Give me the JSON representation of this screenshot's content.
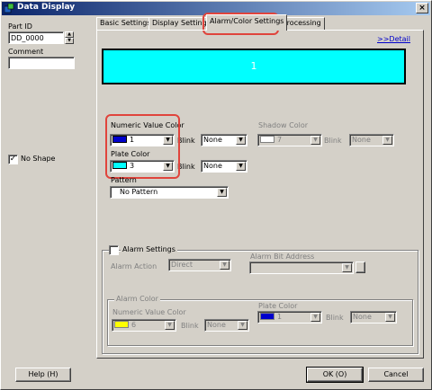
{
  "window": {
    "title": "Data Display",
    "close_glyph": "×"
  },
  "left": {
    "part_id_label": "Part ID",
    "part_id_value": "DD_0000",
    "comment_label": "Comment",
    "comment_value": "",
    "no_shape_label": "No Shape",
    "no_shape_checked": true
  },
  "tabs": [
    {
      "label": "Basic Settings",
      "active": false
    },
    {
      "label": "Display Settings",
      "active": false
    },
    {
      "label": "Alarm/Color Settings",
      "active": true
    },
    {
      "label": "Processing",
      "active": false
    }
  ],
  "detail_link": ">>Detail",
  "preview": {
    "text": "1",
    "background": "#00ffff",
    "text_color": "#ffffff"
  },
  "numeric_value_color": {
    "label": "Numeric Value Color",
    "value": "1",
    "swatch": "#0000cc"
  },
  "plate_color": {
    "label": "Plate Color",
    "value": "3",
    "swatch": "#00ffff"
  },
  "blink_label": "Blink",
  "blink_numeric": "None",
  "blink_plate": "None",
  "shadow_color": {
    "label": "Shadow Color",
    "value": "7",
    "swatch": "#ffffff",
    "blink": "None"
  },
  "pattern": {
    "label": "Pattern",
    "value": "No Pattern"
  },
  "alarm": {
    "settings_label": "Alarm Settings",
    "checked": false,
    "action_label": "Alarm Action",
    "action_value": "Direct",
    "bit_address_label": "Alarm Bit Address",
    "bit_address_value": "",
    "color_group_label": "Alarm Color",
    "numeric_label": "Numeric Value Color",
    "numeric_value": "6",
    "numeric_swatch": "#ffff00",
    "numeric_blink": "None",
    "plate_label": "Plate Color",
    "plate_value": "1",
    "plate_swatch": "#0000cc",
    "plate_blink": "None"
  },
  "buttons": {
    "help": "Help (H)",
    "ok": "OK (O)",
    "cancel": "Cancel"
  },
  "highlight_color": "#e0443c"
}
